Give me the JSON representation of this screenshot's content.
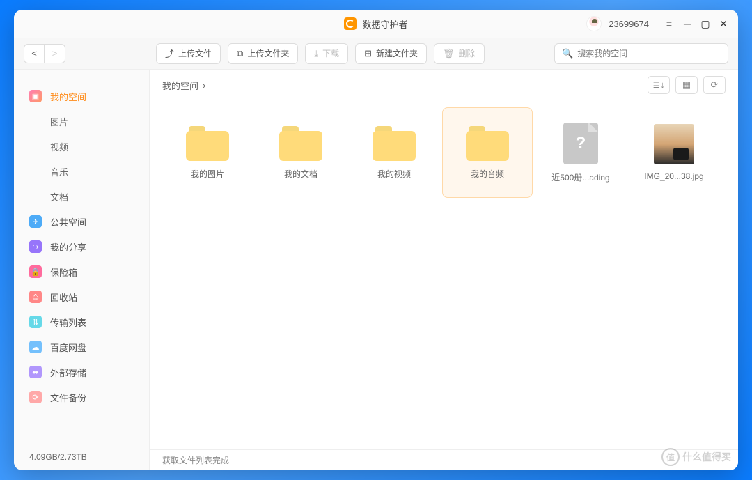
{
  "app": {
    "title": "数据守护者",
    "username": "23699674"
  },
  "toolbar": {
    "upload_file": "上传文件",
    "upload_folder": "上传文件夹",
    "download": "下载",
    "new_folder": "新建文件夹",
    "delete": "删除",
    "search_placeholder": "搜索我的空间"
  },
  "sidebar": {
    "items": [
      {
        "label": "我的空间"
      },
      {
        "label": "图片"
      },
      {
        "label": "视频"
      },
      {
        "label": "音乐"
      },
      {
        "label": "文档"
      },
      {
        "label": "公共空间"
      },
      {
        "label": "我的分享"
      },
      {
        "label": "保险箱"
      },
      {
        "label": "回收站"
      },
      {
        "label": "传输列表"
      },
      {
        "label": "百度网盘"
      },
      {
        "label": "外部存储"
      },
      {
        "label": "文件备份"
      }
    ],
    "storage": "4.09GB/2.73TB"
  },
  "breadcrumb": {
    "path": "我的空间"
  },
  "files": [
    {
      "name": "我的图片",
      "type": "folder"
    },
    {
      "name": "我的文档",
      "type": "folder"
    },
    {
      "name": "我的视频",
      "type": "folder"
    },
    {
      "name": "我的音频",
      "type": "folder",
      "selected": true
    },
    {
      "name": "近500册...ading",
      "type": "file"
    },
    {
      "name": "IMG_20...38.jpg",
      "type": "image"
    }
  ],
  "status": "获取文件列表完成",
  "watermark": "什么值得买"
}
